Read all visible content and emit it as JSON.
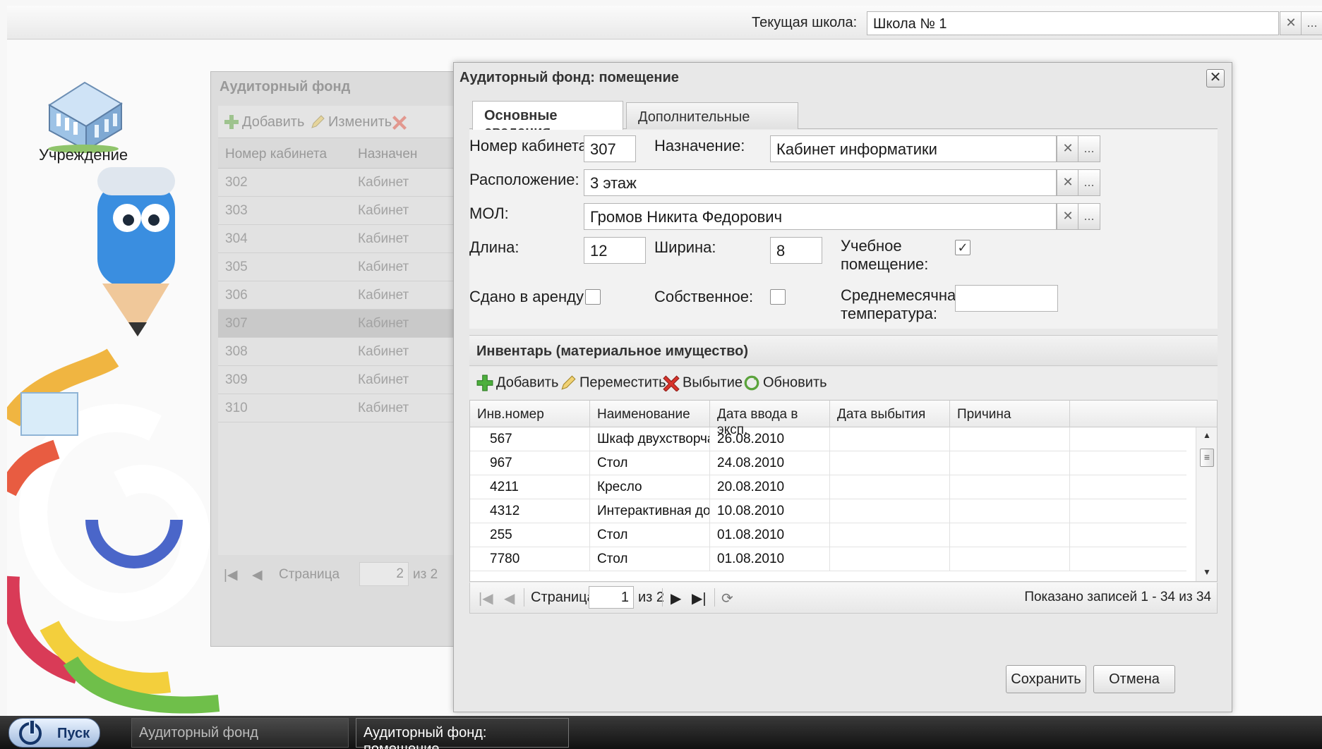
{
  "topbar": {
    "school_label": "Текущая школа:",
    "school_value": "Школа № 1",
    "clear_symbol": "✕",
    "more_symbol": "..."
  },
  "desktop": {
    "icon_label": "Учреждение"
  },
  "bg_window": {
    "title": "Аудиторный фонд",
    "add_label": "Добавить",
    "edit_label": "Изменить",
    "col_number": "Номер кабинета",
    "col_purpose": "Назначен",
    "rows": [
      {
        "num": "302",
        "purpose": "Кабинет"
      },
      {
        "num": "303",
        "purpose": "Кабинет"
      },
      {
        "num": "304",
        "purpose": "Кабинет"
      },
      {
        "num": "305",
        "purpose": "Кабинет"
      },
      {
        "num": "306",
        "purpose": "Кабинет"
      },
      {
        "num": "307",
        "purpose": "Кабинет"
      },
      {
        "num": "308",
        "purpose": "Кабинет"
      },
      {
        "num": "309",
        "purpose": "Кабинет"
      },
      {
        "num": "310",
        "purpose": "Кабинет"
      }
    ],
    "pager_label": "Страница",
    "pager_value": "2",
    "pager_of": "из 2"
  },
  "dialog": {
    "title": "Аудиторный фонд: помещение",
    "close_symbol": "✕",
    "tabs": [
      "Основные сведения",
      "Дополнительные сведения"
    ],
    "fields": {
      "room_number_label": "Номер кабинета:",
      "room_number_value": "307",
      "purpose_label": "Назначение:",
      "purpose_value": "Кабинет информатики",
      "location_label": "Расположение:",
      "location_value": "3 этаж",
      "mol_label": "МОЛ:",
      "mol_value": "Громов Никита Федорович",
      "length_label": "Длина:",
      "length_value": "12",
      "width_label": "Ширина:",
      "width_value": "8",
      "educational_label_1": "Учебное",
      "educational_label_2": "помещение:",
      "educational_checked": true,
      "rented_label": "Сдано в аренду:",
      "rented_checked": false,
      "own_label": "Собственное:",
      "own_checked": false,
      "temperature_label_1": "Среднемесячная",
      "temperature_label_2": "температура:",
      "temperature_value": ""
    },
    "inventory": {
      "section_title": "Инвентарь (материальное имущество)",
      "add_label": "Добавить",
      "move_label": "Переместить",
      "dispose_label": "Выбытие",
      "refresh_label": "Обновить",
      "columns": [
        "Инв.номер",
        "Наименование",
        "Дата ввода в эксп.",
        "Дата выбытия",
        "Причина"
      ],
      "rows": [
        {
          "inv": "567",
          "name": "Шкаф двухстворчат",
          "date_in": "26.08.2010",
          "date_out": "",
          "reason": ""
        },
        {
          "inv": "967",
          "name": "Стол",
          "date_in": "24.08.2010",
          "date_out": "",
          "reason": ""
        },
        {
          "inv": "4211",
          "name": "Кресло",
          "date_in": "20.08.2010",
          "date_out": "",
          "reason": ""
        },
        {
          "inv": "4312",
          "name": "Интерактивная дос",
          "date_in": "10.08.2010",
          "date_out": "",
          "reason": ""
        },
        {
          "inv": "255",
          "name": "Стол",
          "date_in": "01.08.2010",
          "date_out": "",
          "reason": ""
        },
        {
          "inv": "7780",
          "name": "Стол",
          "date_in": "01.08.2010",
          "date_out": "",
          "reason": ""
        }
      ],
      "pager_label": "Страница",
      "pager_value": "1",
      "pager_of": "из 2",
      "records_info": "Показано записей 1 - 34 из 34"
    },
    "save_label": "Сохранить",
    "cancel_label": "Отмена"
  },
  "taskbar": {
    "start_label": "Пуск",
    "tasks": [
      "Аудиторный фонд",
      "Аудиторный фонд: помещение"
    ]
  },
  "colors": {
    "accent_blue": "#153569",
    "add_green": "#4caf3c",
    "delete_red": "#d9332b"
  }
}
